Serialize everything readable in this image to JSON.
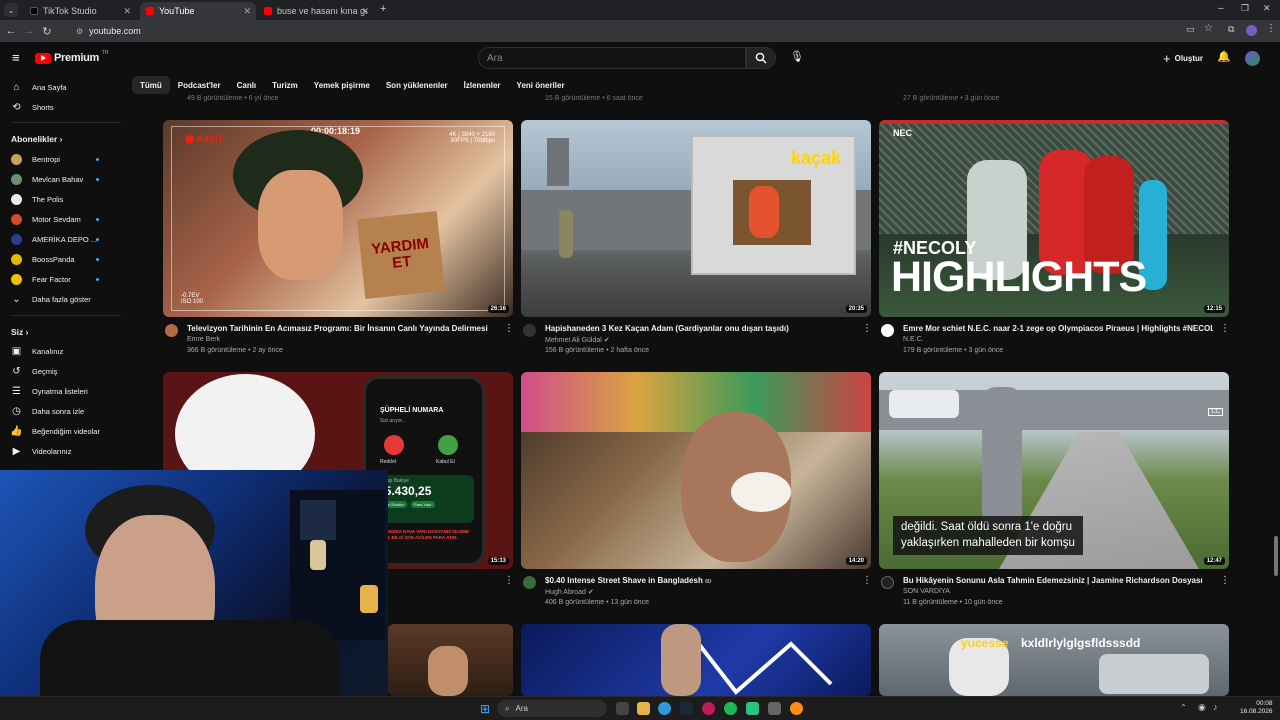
{
  "browser": {
    "tabs": [
      {
        "label": "TikTok Studio",
        "active": false
      },
      {
        "label": "YouTube",
        "active": true
      },
      {
        "label": "buse ve hasanı kına gece 2 - Yo",
        "active": false
      }
    ],
    "url": "youtube.com"
  },
  "header": {
    "logo": "Premium",
    "logo_super": "TR",
    "search_placeholder": "Ara",
    "create_label": "Oluştur"
  },
  "chips": [
    "Tümü",
    "Podcast'ler",
    "Canlı",
    "Turizm",
    "Yemek pişirme",
    "Son yüklenenler",
    "İzlenenler",
    "Yeni öneriler"
  ],
  "sidebar": {
    "main": [
      {
        "label": "Ana Sayfa",
        "icon": "home-icon"
      },
      {
        "label": "Shorts",
        "icon": "shorts-icon"
      }
    ],
    "subs_heading": "Abonelikler",
    "subs": [
      {
        "label": "Bentropi",
        "color": "#c9a15a"
      },
      {
        "label": "Mevlcan Bahav",
        "color": "#6b8f71"
      },
      {
        "label": "The Polis",
        "color": "#eeeeee"
      },
      {
        "label": "Motor Sevdam",
        "color": "#d14b2e"
      },
      {
        "label": "AMERİKA DEPO ...",
        "color": "#2c3e8f"
      },
      {
        "label": "BoossPanda",
        "color": "#e6b800"
      },
      {
        "label": "Fear Factor",
        "color": "#f2c200"
      }
    ],
    "more_label": "Daha fazla göster",
    "you_heading": "Siz",
    "you": [
      {
        "label": "Kanalınız",
        "icon": "channel-icon"
      },
      {
        "label": "Geçmiş",
        "icon": "history-icon"
      },
      {
        "label": "Oynatma listeleri",
        "icon": "playlist-icon"
      },
      {
        "label": "Daha sonra izle",
        "icon": "clock-icon"
      },
      {
        "label": "Beğendiğim videolar",
        "icon": "like-icon"
      },
      {
        "label": "Videolarınız",
        "icon": "video-icon"
      }
    ]
  },
  "prev_row_meta": [
    "49 B görüntüleme • 6 yıl önce",
    "15 B görüntüleme • 6 saat önce",
    "27 B görüntüleme • 3 gün önce"
  ],
  "videos": [
    {
      "title": "Televizyon Tarihinin En Acımasız Programı: Bir İnsanın Canlı Yayında Delirmesi",
      "channel": "Emre Berk",
      "meta": "366 B görüntüleme • 2 ay önce",
      "duration": "26:16",
      "verified": false,
      "overlay": {
        "timer": "00:00:18:19",
        "rec": "KAYIT",
        "specs1": "4K | 3840 × 2160",
        "specs2": "30FPS | 70Mbps",
        "sign": "YARDIM ET",
        "iso": "ISO 100",
        "ev": "-0.7EV"
      }
    },
    {
      "title": "Hapishaneden 3 Kez Kaçan Adam (Gardiyanlar onu dışarı taşıdı)",
      "channel": "Mehmet Ali Güldal",
      "meta": "156 B görüntüleme • 2 hafta önce",
      "duration": "20:35",
      "verified": true,
      "overlay": {
        "word": "kaçak"
      }
    },
    {
      "title": "Emre Mor schiet N.E.C. naar 2-1 zege op Olympiacos Piraeus | Highlights #NECOLY",
      "channel": "N.E.C.",
      "meta": "179 B görüntüleme • 3 gün önce",
      "duration": "12:15",
      "verified": false,
      "overlay": {
        "hashtag": "#NECOLY",
        "big": "HIGHLIGHTS",
        "brand": "NEC"
      }
    },
    {
      "title": "",
      "channel": "",
      "meta": "",
      "duration": "15:13",
      "verified": false,
      "overlay": {
        "caller": "ŞÜPHELİ NUMARA",
        "sub": "Sizi arıyor...",
        "decline": "Reddet",
        "accept": "Kabul Et",
        "balance_label": "Hesap Bakiye",
        "balance": "85.430,25",
        "send": "Para Gönder",
        "request": "Para Yatır",
        "warn": "HAKKINIZDA DAVA VAR! DOSYANIZ İŞLEME ALINDI. BİLGİ İÇİN ACİLEN PARA ATIN."
      }
    },
    {
      "title": "$0.40 Intense Street Shave in Bangladesh",
      "title_badge": "8D",
      "channel": "Hugh Abroad",
      "meta": "406 B görüntüleme • 13 gün önce",
      "duration": "14:20",
      "verified": true,
      "overlay": {}
    },
    {
      "title": "Bu Hikâyenin Sonunu Asla Tahmin Edemezsiniz | Jasmine Richardson Dosyası",
      "channel": "SON VARDİYA",
      "meta": "11 B görüntüleme • 10 gün önce",
      "duration": "12:47",
      "verified": false,
      "overlay": {
        "caption1": "değildi. Saat öldü sonra 1'e doğru",
        "caption2": "yaklaşırken mahalleden bir komşu"
      }
    },
    {
      "title": "",
      "overlay": {}
    },
    {
      "title": "",
      "overlay": {}
    },
    {
      "title": "",
      "overlay": {
        "caption_a": "yucesse",
        "caption_b": "kxldlrlylglgsfldsssdd"
      }
    }
  ],
  "taskbar": {
    "search": "Ara",
    "time": "00:08",
    "date": "16.08.2026"
  },
  "colors": {
    "bg": "#0f0f0f",
    "accent": "#ff0000",
    "link": "#3ea6ff"
  }
}
